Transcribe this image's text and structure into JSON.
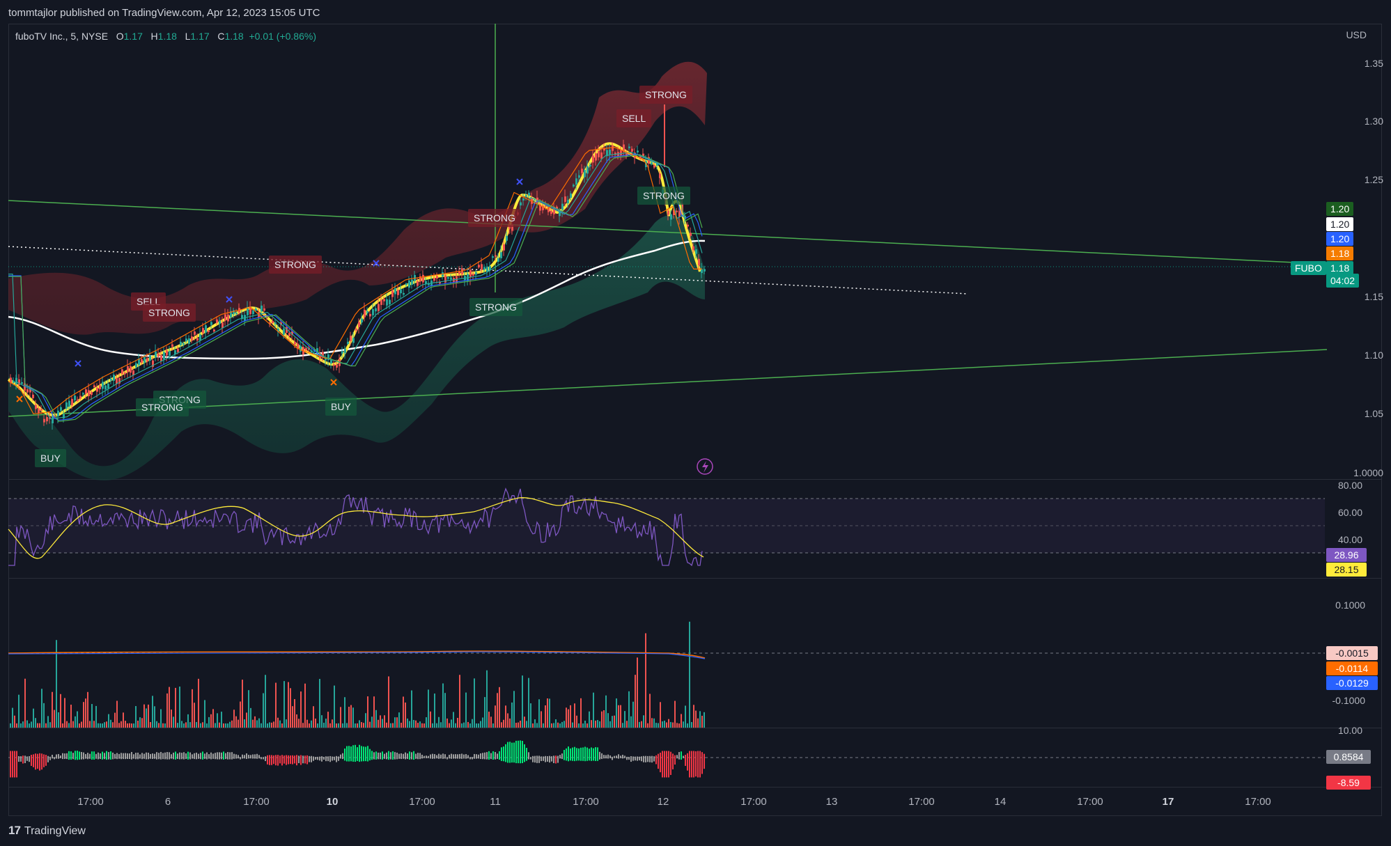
{
  "header": {
    "publisher": "tommtajlor published on TradingView.com, Apr 12, 2023 15:05 UTC"
  },
  "legend": {
    "symbol": "fuboTV Inc., 5, NYSE",
    "o_label": "O",
    "o_value": "1.17",
    "h_label": "H",
    "h_value": "1.18",
    "l_label": "L",
    "l_value": "1.17",
    "c_label": "C",
    "c_value": "1.18",
    "change": "+0.01 (+0.86%)"
  },
  "price_axis": {
    "currency": "USD",
    "ticks": [
      "1.35",
      "1.30",
      "1.25",
      "1.10",
      "1.05",
      "1.0000"
    ],
    "tags": [
      {
        "text": "1.20",
        "bg": "#1b5e20",
        "fg": "#ffffff"
      },
      {
        "text": "1.20",
        "bg": "#ffffff",
        "fg": "#131722"
      },
      {
        "text": "1.20",
        "bg": "#2962ff",
        "fg": "#ffffff"
      },
      {
        "text": "1.18",
        "bg": "#f57c00",
        "fg": "#ffffff"
      },
      {
        "text": "1.18",
        "bg": "#089981",
        "fg": "#ffffff"
      },
      {
        "text": "04:02",
        "bg": "#089981",
        "fg": "#ffffff"
      }
    ],
    "symbol_tag": "FUBO",
    "hidden_tick": "1.15"
  },
  "signals": [
    {
      "text": "STRONG",
      "color": "red"
    },
    {
      "text": "SELL",
      "color": "red"
    },
    {
      "text": "STRONG",
      "color": "green"
    },
    {
      "text": "STRONG",
      "color": "red"
    },
    {
      "text": "STRONG",
      "color": "red"
    },
    {
      "text": "STRONG",
      "color": "green"
    },
    {
      "text": "SELL",
      "color": "red"
    },
    {
      "text": "STRONG",
      "color": "red"
    },
    {
      "text": "STRONG",
      "color": "green"
    },
    {
      "text": "STRONG",
      "color": "green"
    },
    {
      "text": "BUY",
      "color": "green"
    },
    {
      "text": "BUY",
      "color": "green"
    }
  ],
  "rsi_axis": {
    "ticks": [
      "80.00",
      "60.00",
      "40.00"
    ],
    "tags": [
      {
        "text": "28.96",
        "bg": "#7e57c2",
        "fg": "#ffffff"
      },
      {
        "text": "28.15",
        "bg": "#ffeb3b",
        "fg": "#131722"
      }
    ]
  },
  "macd_axis": {
    "ticks": [
      "0.1000",
      "-0.1000"
    ],
    "tags": [
      {
        "text": "-0.0015",
        "bg": "#f8c9c4",
        "fg": "#131722"
      },
      {
        "text": "-0.0114",
        "bg": "#ff6d00",
        "fg": "#ffffff"
      },
      {
        "text": "-0.0129",
        "bg": "#2962ff",
        "fg": "#ffffff"
      }
    ]
  },
  "osc_axis": {
    "ticks": [
      "10.00"
    ],
    "tags": [
      {
        "text": "0.8584",
        "bg": "#787b86",
        "fg": "#ffffff"
      },
      {
        "text": "-8.59",
        "bg": "#f23645",
        "fg": "#ffffff"
      }
    ]
  },
  "time_axis": [
    "17:00",
    "6",
    "17:00",
    "10",
    "17:00",
    "11",
    "17:00",
    "12",
    "17:00",
    "13",
    "17:00",
    "14",
    "17:00",
    "17",
    "17:00"
  ],
  "time_axis_bold": [
    "10",
    "17"
  ],
  "footer": {
    "logo_mark": "17",
    "brand": "TradingView"
  },
  "icons": {
    "alert": "lightning-icon"
  },
  "colors": {
    "background": "#131722",
    "up_candle": "#26a69a",
    "down_candle": "#ef5350",
    "ema_yellow": "#ffeb3b",
    "ma_white": "#ffffff",
    "trendline": "#4caf50",
    "rsi": "#7e57c2"
  }
}
